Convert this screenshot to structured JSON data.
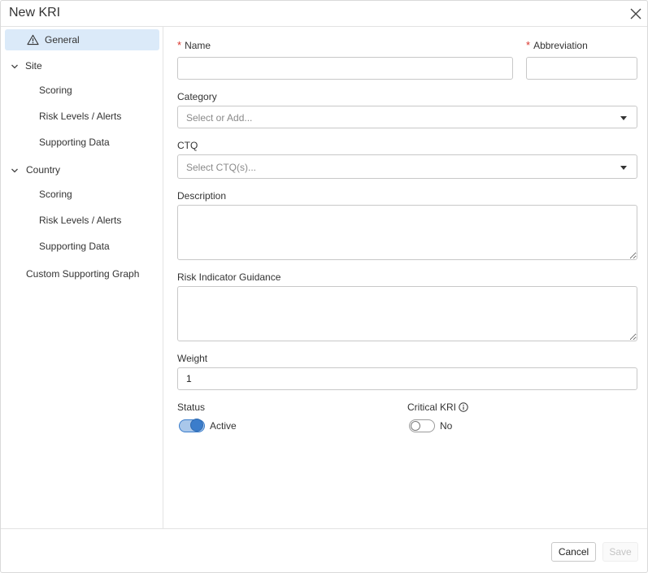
{
  "dialog": {
    "title": "New KRI",
    "close_icon": "close-icon"
  },
  "sidebar": {
    "general": {
      "label": "General",
      "icon": "warning-icon"
    },
    "site": {
      "label": "Site",
      "children": [
        "Scoring",
        "Risk Levels / Alerts",
        "Supporting Data"
      ]
    },
    "country": {
      "label": "Country",
      "children": [
        "Scoring",
        "Risk Levels / Alerts",
        "Supporting Data"
      ]
    },
    "custom_graph": {
      "label": "Custom Supporting Graph"
    }
  },
  "form": {
    "required_marker": "*",
    "name": {
      "label": "Name",
      "value": ""
    },
    "abbreviation": {
      "label": "Abbreviation",
      "value": ""
    },
    "category": {
      "label": "Category",
      "placeholder": "Select or Add..."
    },
    "ctq": {
      "label": "CTQ",
      "placeholder": "Select CTQ(s)..."
    },
    "description": {
      "label": "Description",
      "value": ""
    },
    "guidance": {
      "label": "Risk Indicator Guidance",
      "value": ""
    },
    "weight": {
      "label": "Weight",
      "value": "1"
    },
    "status": {
      "label": "Status",
      "value": "Active",
      "on": true
    },
    "critical": {
      "label": "Critical KRI",
      "value": "No",
      "on": false,
      "icon": "info-icon"
    }
  },
  "footer": {
    "cancel_label": "Cancel",
    "save_label": "Save"
  },
  "colors": {
    "accent": "#3b7dcb",
    "active_nav_bg": "#dbeaf9",
    "required": "#d9342b"
  }
}
